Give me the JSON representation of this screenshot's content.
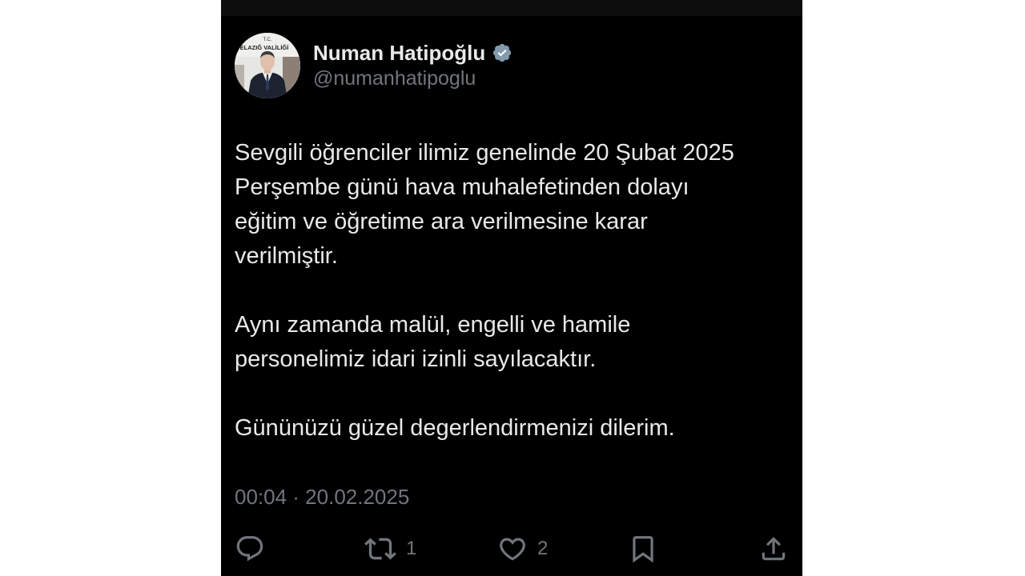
{
  "tweet": {
    "author": {
      "display_name": "Numan Hatipoğlu",
      "handle": "@numanhatipoglu",
      "verified": true,
      "avatar_sign_line1": "T.C.",
      "avatar_sign_line2": "ELAZIĞ VALİLİĞİ"
    },
    "text": {
      "paragraph1": "Sevgili öğrenciler ilimiz genelinde 20 Şubat 2025\nPerşembe günü hava muhalefetinden dolayı\neğitim ve öğretime ara verilmesine karar\nverilmiştir.",
      "paragraph2": "Aynı zamanda malül, engelli ve hamile\npersonelimiz idari izinli sayılacaktır.",
      "paragraph3": "Gününüzü güzel degerlendirmenizi dilerim."
    },
    "timestamp": "00:04 · 20.02.2025",
    "actions": {
      "reply_icon": "reply-icon",
      "retweet_icon": "retweet-icon",
      "retweet_count": "1",
      "like_icon": "heart-icon",
      "like_count": "2",
      "bookmark_icon": "bookmark-icon",
      "share_icon": "share-icon"
    }
  },
  "colors": {
    "background": "#000000",
    "text_primary": "#e7e9ea",
    "text_secondary": "#71767b",
    "verified_badge": "#829aab"
  }
}
